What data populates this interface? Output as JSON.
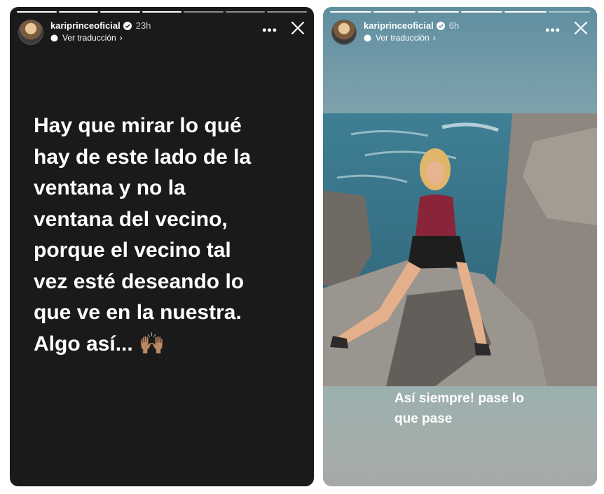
{
  "stories": [
    {
      "username": "kariprinceoficial",
      "time": "23h",
      "translate_label": "Ver traducción",
      "text_lines": [
        "Hay que mirar lo qué",
        "hay de este lado de la",
        "ventana y no la",
        "ventana del vecino,",
        "porque el vecino tal",
        "vez esté deseando lo",
        "que ve en la nuestra.",
        "Algo así..."
      ],
      "emoji": "🙌🏽",
      "more_icon": "more-horizontal-icon",
      "close_icon": "close-icon"
    },
    {
      "username": "kariprinceoficial",
      "time": "6h",
      "translate_label": "Ver traducción",
      "caption_lines": [
        "Así siempre! pase lo",
        "que pase"
      ],
      "more_icon": "more-horizontal-icon",
      "close_icon": "close-icon"
    }
  ],
  "colors": {
    "left_bg": "#1a1a1a",
    "right_top": "#5f8fa0",
    "right_bottom": "#a6aaa6",
    "text": "#ffffff"
  }
}
